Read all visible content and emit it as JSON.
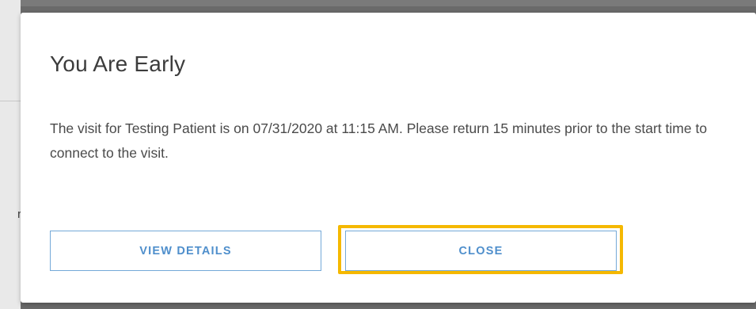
{
  "background": {
    "fragment_text": "re"
  },
  "modal": {
    "title": "You Are Early",
    "message": "The visit for Testing Patient is on 07/31/2020 at 11:15 AM. Please return 15 minutes prior to the start time to connect to the visit.",
    "buttons": {
      "view_details": "VIEW DETAILS",
      "close": "CLOSE"
    }
  },
  "colors": {
    "button_text": "#4f8fcc",
    "button_border": "#74a9d8",
    "highlight": "#f5b800",
    "overlay": "#6a6a6a"
  }
}
